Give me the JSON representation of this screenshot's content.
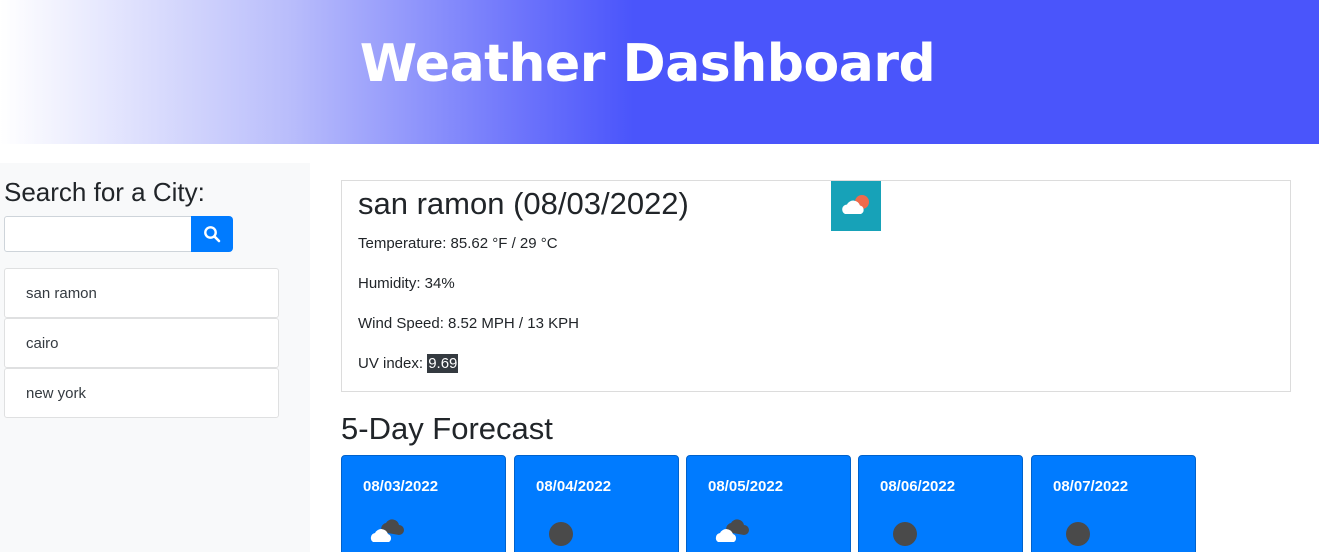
{
  "header": {
    "title": "Weather Dashboard"
  },
  "sidebar": {
    "search_title": "Search for a City:",
    "search_value": "",
    "search_placeholder": "",
    "search_icon": "search-icon",
    "cities": [
      "san ramon",
      "cairo",
      "new york"
    ]
  },
  "current": {
    "title": "san ramon (08/03/2022)",
    "icon": "partly-cloudy-day-icon",
    "temperature": "Temperature: 85.62 °F / 29 °C",
    "humidity": "Humidity: 34%",
    "wind": "Wind Speed: 8.52 MPH / 13 KPH",
    "uv_label": "UV index: ",
    "uv_value": "9.69"
  },
  "forecast": {
    "title": "5-Day Forecast",
    "days": [
      {
        "date": "08/03/2022",
        "icon": "broken-clouds-icon"
      },
      {
        "date": "08/04/2022",
        "icon": "overcast-icon"
      },
      {
        "date": "08/05/2022",
        "icon": "broken-clouds-icon"
      },
      {
        "date": "08/06/2022",
        "icon": "overcast-icon"
      },
      {
        "date": "08/07/2022",
        "icon": "overcast-icon"
      }
    ]
  },
  "colors": {
    "header_accent": "#4a55fb",
    "primary": "#007bff",
    "icon_bg": "#17a2b8",
    "uv_bg": "#343a40"
  }
}
